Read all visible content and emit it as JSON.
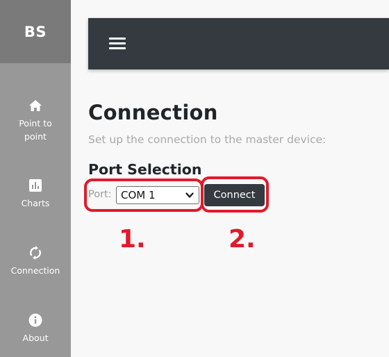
{
  "sidebar": {
    "brand": "BS",
    "items": [
      {
        "label": "Point to point",
        "icon": "home-icon"
      },
      {
        "label": "Charts",
        "icon": "bar-chart-icon"
      },
      {
        "label": "Connection",
        "icon": "sync-icon"
      },
      {
        "label": "About",
        "icon": "info-icon"
      }
    ]
  },
  "topbar": {
    "menu_icon": "hamburger-icon"
  },
  "main": {
    "title": "Connection",
    "subtitle": "Set up the connection to the master device:",
    "section_title": "Port Selection",
    "port_label": "Port:",
    "port_value": "COM 1",
    "connect_label": "Connect"
  },
  "annotations": {
    "step1": "1.",
    "step2": "2.",
    "highlight_color": "#e11a2a"
  },
  "colors": {
    "sidebar": "#989898",
    "brand_bg": "#7a7a7a",
    "topbar": "#343a40",
    "button": "#343a40",
    "background": "#f8f8f8"
  }
}
